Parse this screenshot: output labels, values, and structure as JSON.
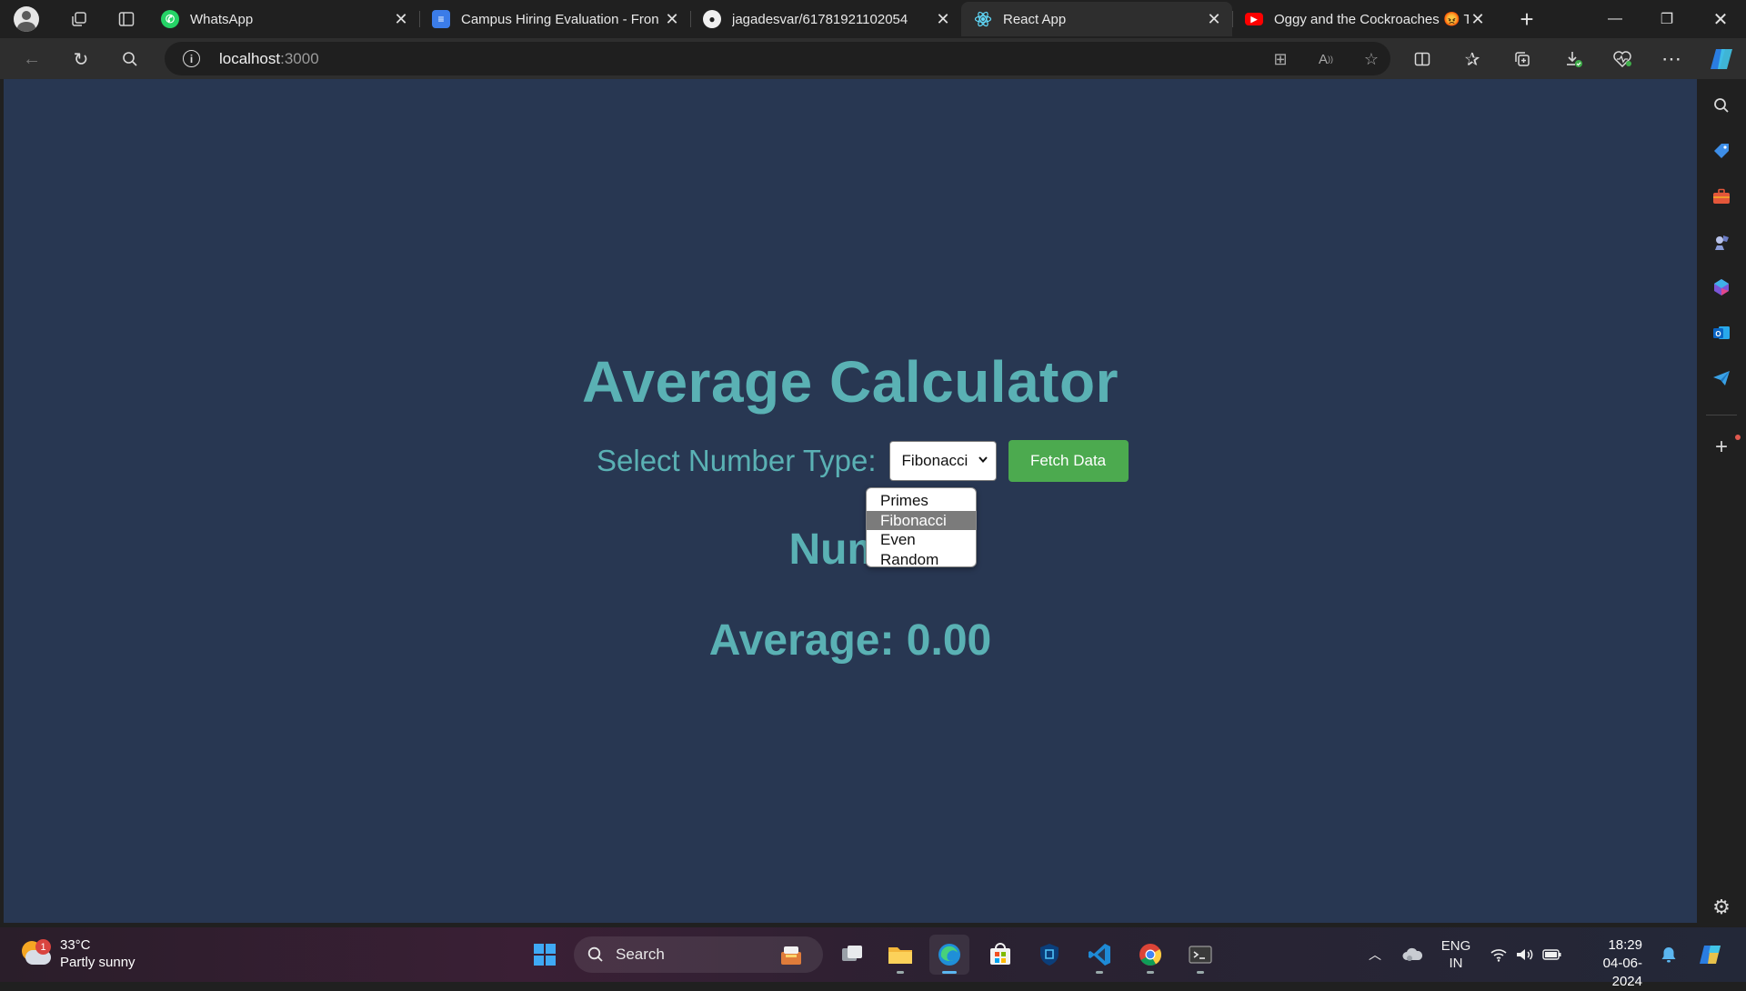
{
  "browser": {
    "tabs": [
      {
        "title": "WhatsApp",
        "icon": "whatsapp-icon",
        "active": false
      },
      {
        "title": "Campus Hiring Evaluation - Fron",
        "icon": "google-docs-icon",
        "active": false
      },
      {
        "title": "jagadesvar/61781921102054",
        "icon": "github-icon",
        "active": false
      },
      {
        "title": "React App",
        "icon": "react-icon",
        "active": true
      },
      {
        "title": "Oggy and the Cockroaches 😡 T",
        "icon": "youtube-icon",
        "active": false
      }
    ],
    "address": {
      "host": "localhost",
      "port": ":3000"
    }
  },
  "page": {
    "title": "Average Calculator",
    "select_label": "Select Number Type:",
    "selected_type": "Fibonacci",
    "options": [
      "Primes",
      "Fibonacci",
      "Even",
      "Random"
    ],
    "fetch_button": "Fetch Data",
    "numbers_heading": "Numb",
    "average_label": "Average: 0.00"
  },
  "taskbar": {
    "weather_temp": "33°C",
    "weather_desc": "Partly sunny",
    "weather_badge": "1",
    "search_label": "Search",
    "lang_top": "ENG",
    "lang_bottom": "IN",
    "time": "18:29",
    "date": "04-06-2024"
  },
  "colors": {
    "page_bg": "#283752",
    "accent_text": "#5ab1b4",
    "fetch_button": "#4caa4f"
  }
}
